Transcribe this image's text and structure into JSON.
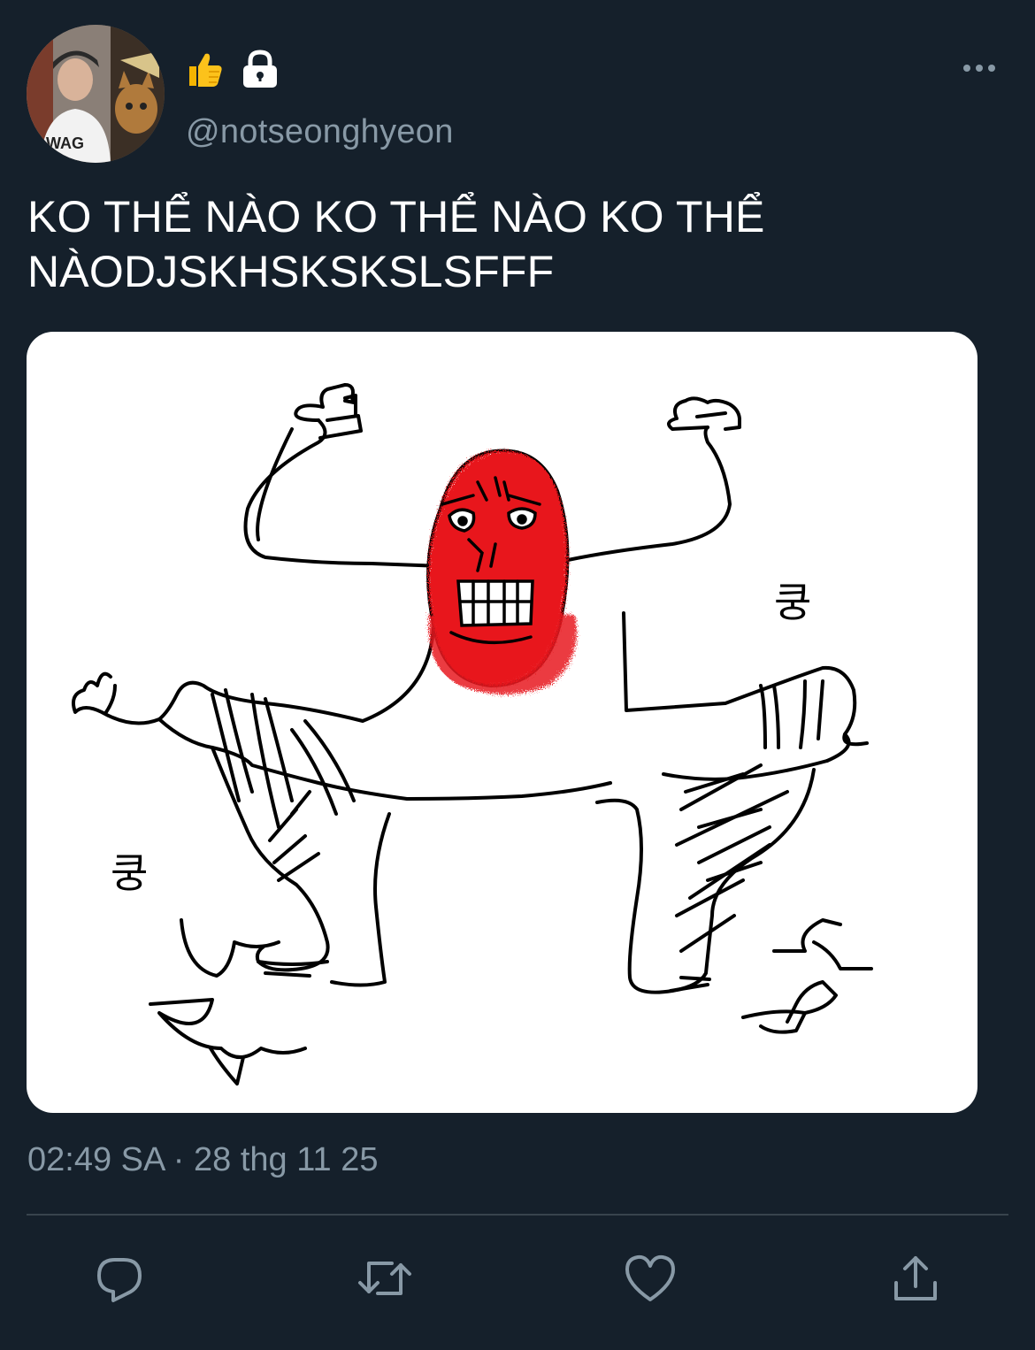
{
  "tweet": {
    "author": {
      "handle": "@notseonghyeon",
      "name_emojis": [
        "thumbs-up-icon",
        "lock-icon"
      ]
    },
    "text": "KO THỂ NÀO KO THỂ NÀO KO THỂ NÀODJSKHSKSKSLSFFF",
    "media": {
      "sound_effect_label": "쿵"
    },
    "timestamp": "02:49 SA · 28 thg 11 25",
    "actions": [
      "reply-icon",
      "retweet-icon",
      "like-icon",
      "share-icon"
    ]
  },
  "colors": {
    "background": "#15202b",
    "secondary_text": "#8899a6",
    "divider": "#38444d",
    "primary_text": "#ffffff",
    "face_red": "#e8141c"
  }
}
